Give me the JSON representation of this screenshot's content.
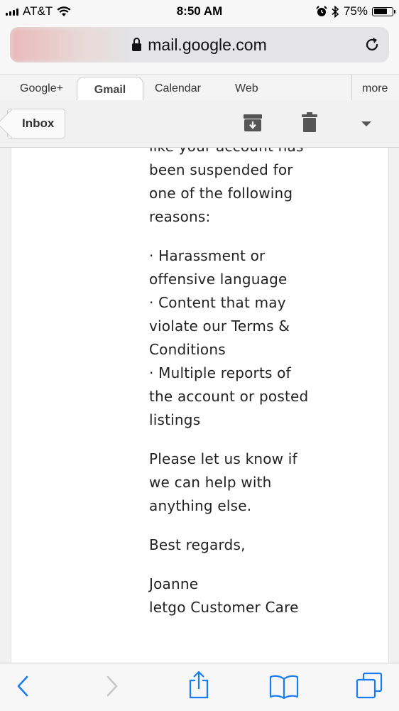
{
  "status_bar": {
    "carrier": "AT&T",
    "time": "8:50 AM",
    "battery_percent": "75%",
    "battery_level": 0.75
  },
  "browser": {
    "url": "mail.google.com"
  },
  "tabs": [
    {
      "label": "Google+"
    },
    {
      "label": "Gmail",
      "active": true
    },
    {
      "label": "Calendar"
    },
    {
      "label": "Web"
    },
    {
      "label": "more"
    }
  ],
  "toolbar": {
    "inbox_label": "Inbox"
  },
  "email": {
    "para1": [
      "like your account has",
      "been suspended for",
      "one of the following",
      "reasons:"
    ],
    "para2": [
      "· Harassment or",
      "offensive language",
      "· Content that may",
      "violate our Terms &",
      "Conditions",
      "· Multiple reports of",
      "the account or posted",
      "listings"
    ],
    "para3": [
      "Please let us know if",
      "we can help with",
      "anything else."
    ],
    "para4": [
      "Best regards,"
    ],
    "para5": [
      "Joanne",
      "letgo Customer Care"
    ]
  },
  "colors": {
    "accent": "#1a7cf5"
  }
}
